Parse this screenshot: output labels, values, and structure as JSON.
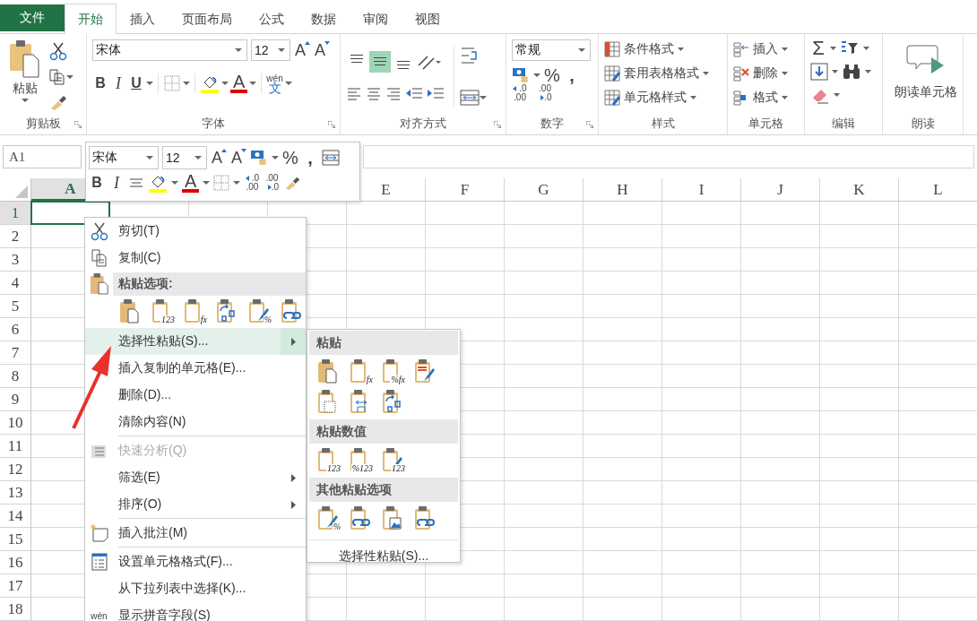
{
  "tabs": [
    {
      "label": "文件",
      "kind": "file",
      "selected": false
    },
    {
      "label": "开始",
      "kind": "tab",
      "selected": true
    },
    {
      "label": "插入",
      "kind": "tab",
      "selected": false
    },
    {
      "label": "页面布局",
      "kind": "tab",
      "selected": false
    },
    {
      "label": "公式",
      "kind": "tab",
      "selected": false
    },
    {
      "label": "数据",
      "kind": "tab",
      "selected": false
    },
    {
      "label": "审阅",
      "kind": "tab",
      "selected": false
    },
    {
      "label": "视图",
      "kind": "tab",
      "selected": false
    }
  ],
  "ribbon": {
    "clipboard": {
      "paste": "粘贴",
      "label": "剪贴板"
    },
    "font": {
      "name": "宋体",
      "size": "12",
      "grow": "A",
      "shrink": "A",
      "bold": "B",
      "italic": "I",
      "underline": "U",
      "color_glyph": "A",
      "phonetic_top": "wén",
      "phonetic_bottom": "文",
      "label": "字体"
    },
    "alignment": {
      "vertical": [
        {
          "selected": false
        },
        {
          "selected": true
        },
        {
          "selected": false
        }
      ],
      "label": "对齐方式"
    },
    "number": {
      "format": "常规",
      "percent": "%",
      "comma": ",",
      "inc_decimal": [
        ".0",
        ".00"
      ],
      "dec_decimal": [
        ".00",
        ".0"
      ],
      "label": "数字"
    },
    "styles": {
      "items": [
        "条件格式",
        "套用表格格式",
        "单元格样式"
      ],
      "label": "样式"
    },
    "cells": {
      "items": [
        "插入",
        "删除",
        "格式"
      ],
      "label": "单元格"
    },
    "editing": {
      "sum": "Σ",
      "label": "编辑"
    },
    "speak": {
      "button": "朗读单元格",
      "label": "朗读"
    }
  },
  "name_box": "A1",
  "mini_toolbar": {
    "font": "宋体",
    "size": "12",
    "grow": "A",
    "shrink": "A",
    "percent": "%",
    "comma": ",",
    "bold": "B",
    "italic": "I",
    "color_glyph": "A",
    "inc_decimal": [
      ".0",
      ".00"
    ],
    "dec_decimal": [
      ".00",
      ".0"
    ]
  },
  "columns": [
    {
      "label": "A",
      "selected": true
    },
    {
      "label": "E",
      "selected": false
    },
    {
      "label": "F",
      "selected": false
    },
    {
      "label": "G",
      "selected": false
    },
    {
      "label": "H",
      "selected": false
    },
    {
      "label": "I",
      "selected": false
    },
    {
      "label": "J",
      "selected": false
    },
    {
      "label": "K",
      "selected": false
    },
    {
      "label": "L",
      "selected": false
    }
  ],
  "rows": [
    {
      "label": "1",
      "selected": true
    },
    {
      "label": "2",
      "selected": false
    },
    {
      "label": "3",
      "selected": false
    },
    {
      "label": "4",
      "selected": false
    },
    {
      "label": "5",
      "selected": false
    },
    {
      "label": "6",
      "selected": false
    },
    {
      "label": "7",
      "selected": false
    },
    {
      "label": "8",
      "selected": false
    },
    {
      "label": "9",
      "selected": false
    },
    {
      "label": "10",
      "selected": false
    },
    {
      "label": "11",
      "selected": false
    },
    {
      "label": "12",
      "selected": false
    },
    {
      "label": "13",
      "selected": false
    },
    {
      "label": "14",
      "selected": false
    },
    {
      "label": "15",
      "selected": false
    },
    {
      "label": "16",
      "selected": false
    },
    {
      "label": "17",
      "selected": false
    },
    {
      "label": "18",
      "selected": false
    }
  ],
  "context_menu": {
    "items": [
      {
        "kind": "command",
        "label": "剪切(T)",
        "selected": false,
        "disabled": false,
        "submenu": false,
        "divider_above": false
      },
      {
        "kind": "command",
        "label": "复制(C)",
        "selected": false,
        "disabled": false,
        "submenu": false,
        "divider_above": false
      },
      {
        "kind": "header",
        "label": "粘贴选项:"
      },
      {
        "kind": "icons",
        "icons": [
          {
            "kind": "doc"
          },
          {
            "kind": "plain",
            "badge": "123"
          },
          {
            "kind": "plain",
            "badge": "fx"
          },
          {
            "kind": "transpose"
          },
          {
            "kind": "brush",
            "badge": "%"
          },
          {
            "kind": "link"
          }
        ]
      },
      {
        "kind": "command",
        "label": "选择性粘贴(S)...",
        "selected": true,
        "disabled": false,
        "submenu": true,
        "divider_above": false
      },
      {
        "kind": "command",
        "label": "插入复制的单元格(E)...",
        "selected": false,
        "disabled": false,
        "submenu": false,
        "divider_above": false
      },
      {
        "kind": "command",
        "label": "删除(D)...",
        "selected": false,
        "disabled": false,
        "submenu": false,
        "divider_above": false
      },
      {
        "kind": "command",
        "label": "清除内容(N)",
        "selected": false,
        "disabled": false,
        "submenu": false,
        "divider_above": false
      },
      {
        "kind": "command",
        "label": "快速分析(Q)",
        "selected": false,
        "disabled": true,
        "submenu": false,
        "divider_above": true
      },
      {
        "kind": "command",
        "label": "筛选(E)",
        "selected": false,
        "disabled": false,
        "submenu": true,
        "divider_above": false
      },
      {
        "kind": "command",
        "label": "排序(O)",
        "selected": false,
        "disabled": false,
        "submenu": true,
        "divider_above": false
      },
      {
        "kind": "command",
        "label": "插入批注(M)",
        "selected": false,
        "disabled": false,
        "submenu": false,
        "divider_above": true
      },
      {
        "kind": "command",
        "label": "设置单元格格式(F)...",
        "selected": false,
        "disabled": false,
        "submenu": false,
        "divider_above": true
      },
      {
        "kind": "command",
        "label": "从下拉列表中选择(K)...",
        "selected": false,
        "disabled": false,
        "submenu": false,
        "divider_above": false
      },
      {
        "kind": "command",
        "label": "显示拼音字段(S)",
        "icon_text": "wén",
        "selected": false,
        "disabled": false,
        "submenu": false,
        "divider_above": false
      }
    ]
  },
  "submenu": {
    "sections": [
      {
        "title": "粘贴",
        "icons": [
          {
            "kind": "doc"
          },
          {
            "kind": "plain",
            "badge": "fx"
          },
          {
            "kind": "plain",
            "badge": "%fx"
          },
          {
            "kind": "keep"
          },
          {
            "kind": "border"
          },
          {
            "kind": "width"
          },
          {
            "kind": "transpose"
          }
        ]
      },
      {
        "title": "粘贴数值",
        "icons": [
          {
            "kind": "plain",
            "badge": "123"
          },
          {
            "kind": "plain",
            "badge": "%123"
          },
          {
            "kind": "brush",
            "badge": "123"
          }
        ]
      },
      {
        "title": "其他粘贴选项",
        "icons": [
          {
            "kind": "brush",
            "badge": "%"
          },
          {
            "kind": "link"
          },
          {
            "kind": "picture"
          },
          {
            "kind": "linkpicture"
          }
        ]
      }
    ],
    "footer": "选择性粘贴(S)..."
  }
}
